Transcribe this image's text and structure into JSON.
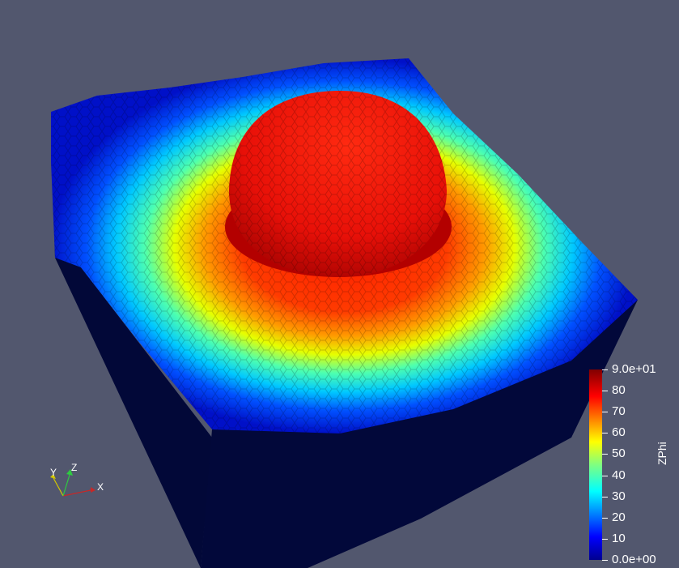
{
  "colorbar": {
    "title": "ZPhi",
    "labels": [
      "9.0e+01",
      "80",
      "70",
      "60",
      "50",
      "40",
      "30",
      "20",
      "10",
      "0.0e+00"
    ],
    "values": [
      90,
      80,
      70,
      60,
      50,
      40,
      30,
      20,
      10,
      0
    ],
    "range": [
      0,
      90
    ],
    "colormap": "jet"
  },
  "orientation_axes": {
    "x_label": "X",
    "y_label": "Y",
    "z_label": "Z",
    "x_color": "#c62828",
    "y_color": "#d4c800",
    "z_color": "#2ecc40"
  },
  "scene": {
    "background": "#52576e",
    "box_side_color": "#020838"
  }
}
